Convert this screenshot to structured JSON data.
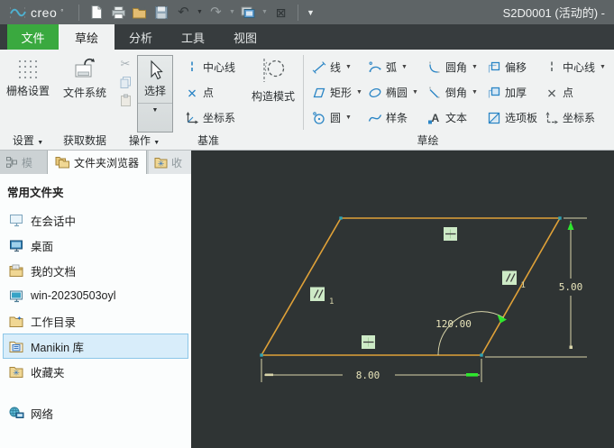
{
  "titlebar": {
    "logo_text": "creo",
    "title": "S2D0001 (活动的) -",
    "quick_access_icons": [
      "new-file",
      "print",
      "open",
      "save",
      "undo",
      "redo",
      "switch-windows",
      "close",
      "customize-toolbar"
    ]
  },
  "tabs": [
    {
      "label": "文件"
    },
    {
      "label": "草绘"
    },
    {
      "label": "分析"
    },
    {
      "label": "工具"
    },
    {
      "label": "视图"
    }
  ],
  "ribbon": {
    "settings": {
      "button_label": "栅格设置",
      "footer": "设置"
    },
    "get_data": {
      "button_label": "文件系统",
      "footer": "获取数据"
    },
    "operations": {
      "select_label": "选择",
      "footer": "操作"
    },
    "datum": {
      "items": [
        {
          "label": "中心线"
        },
        {
          "label": "点"
        },
        {
          "label": "坐标系"
        }
      ],
      "footer": "基准"
    },
    "sketch": {
      "construction_label": "构造模式",
      "footer": "草绘",
      "tools": [
        {
          "label": "线"
        },
        {
          "label": "矩形"
        },
        {
          "label": "圆"
        },
        {
          "label": "弧"
        },
        {
          "label": "椭圆"
        },
        {
          "label": "样条"
        },
        {
          "label": "圆角"
        },
        {
          "label": "倒角"
        },
        {
          "label": "文本"
        },
        {
          "label": "偏移"
        },
        {
          "label": "加厚"
        },
        {
          "label": "选项板"
        },
        {
          "label": "中心线"
        },
        {
          "label": "点"
        },
        {
          "label": "坐标系"
        }
      ]
    }
  },
  "panel": {
    "tabs": {
      "model_partial": "模",
      "browser": "文件夹浏览器",
      "favorites_partial": "收"
    },
    "header": "常用文件夹",
    "items": [
      {
        "label": "在会话中"
      },
      {
        "label": "桌面"
      },
      {
        "label": "我的文档"
      },
      {
        "label": "win-20230503oyl"
      },
      {
        "label": "工作目录"
      },
      {
        "label": "Manikin 库"
      },
      {
        "label": "收藏夹"
      },
      {
        "label": "网络"
      }
    ],
    "selected_item": "Manikin 库"
  },
  "sketch": {
    "dimensions": {
      "height": "5.00",
      "width": "8.00",
      "angle": "120.00"
    },
    "constraints": {
      "parallel_group": "1"
    },
    "colors": {
      "geometry_orange": "#dfa138",
      "dimension_khaki": "#e8e4ba",
      "constraint_green_bg": "#cdeac6",
      "highlight_green": "#2ee62e",
      "vertex_teal": "#2fa3b4",
      "canvas_background": "#2f3434",
      "accent_green": "#3aa93f",
      "icon_blue": "#2a85c5"
    }
  }
}
